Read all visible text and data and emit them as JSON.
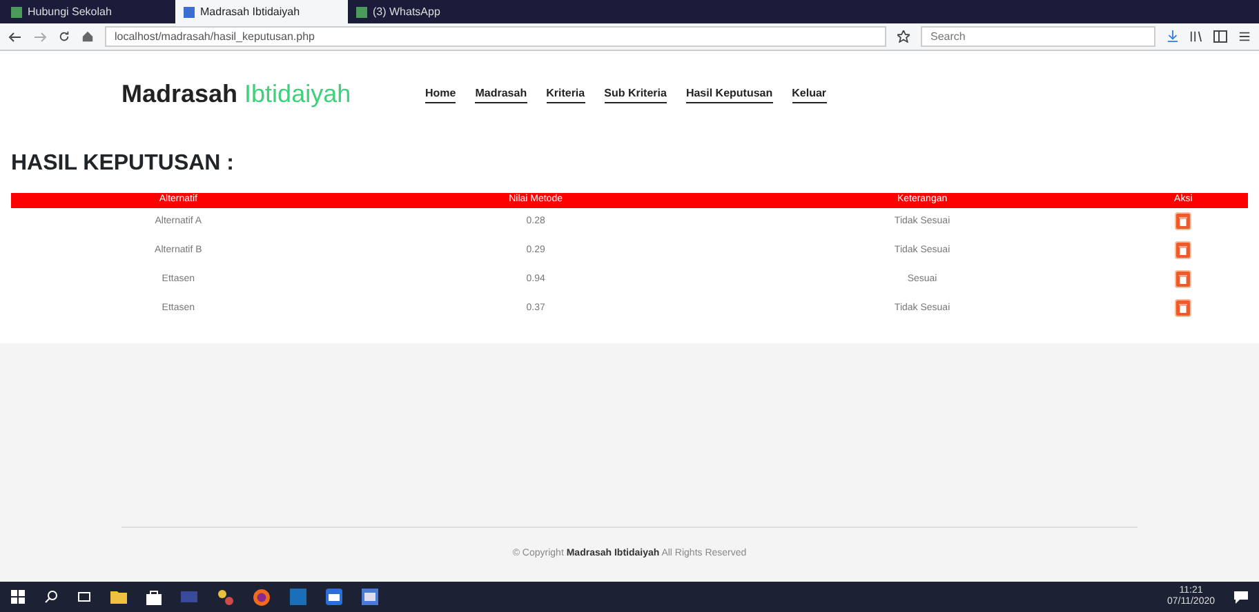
{
  "browser": {
    "tabs": [
      {
        "title": "Hubungi Sekolah",
        "selected": false
      },
      {
        "title": "Madrasah Ibtidaiyah",
        "selected": true
      },
      {
        "title": "(3) WhatsApp",
        "selected": false
      }
    ],
    "address": "localhost/madrasah/hasil_keputusan.php",
    "search_placeholder": "Search"
  },
  "site": {
    "brand_dark": "Madrasah",
    "brand_light": "Ibtidaiyah",
    "nav": [
      "Home",
      "Madrasah",
      "Kriteria",
      "Sub Kriteria",
      "Hasil Keputusan",
      "Keluar"
    ]
  },
  "heading": "HASIL KEPUTUSAN :",
  "table": {
    "columns": [
      "Alternatif",
      "Nilai Metode",
      "Keterangan",
      "Aksi"
    ],
    "rows": [
      {
        "alternatif": "Alternatif A",
        "nilai": "0.28",
        "keterangan": "Tidak Sesuai"
      },
      {
        "alternatif": "Alternatif B",
        "nilai": "0.29",
        "keterangan": "Tidak Sesuai"
      },
      {
        "alternatif": "Ettasen",
        "nilai": "0.94",
        "keterangan": "Sesuai"
      },
      {
        "alternatif": "Ettasen",
        "nilai": "0.37",
        "keterangan": "Tidak Sesuai"
      }
    ]
  },
  "footer": "© Copyright **Madrasah Ibtidaiyah** All Rights Reserved",
  "taskbar": {
    "time": "11:21",
    "date": "07/11/2020"
  }
}
